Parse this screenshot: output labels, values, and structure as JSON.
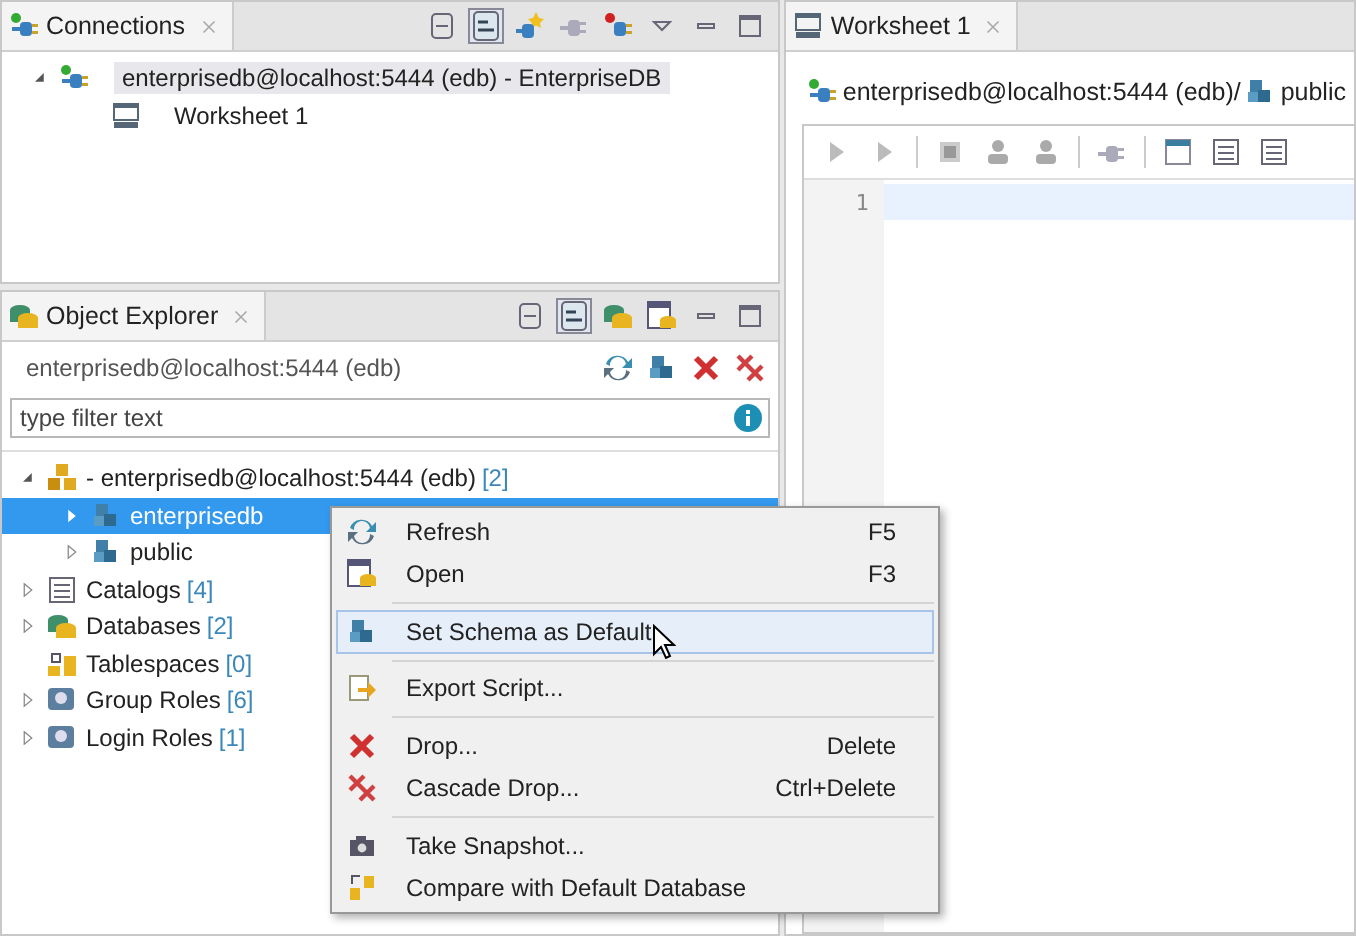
{
  "connections": {
    "tab": "Connections",
    "tree": [
      {
        "label": "enterprisedb@localhost:5444 (edb) - EnterpriseDB",
        "expanded": true,
        "selected": true,
        "children": [
          {
            "label": "Worksheet 1",
            "selected": false
          }
        ]
      }
    ]
  },
  "worksheet": {
    "tab": "Worksheet 1",
    "connection": "enterprisedb@localhost:5444 (edb)/",
    "schema": "public",
    "line_numbers": [
      "1"
    ]
  },
  "object_explorer": {
    "tab": "Object Explorer",
    "connection": "enterprisedb@localhost:5444 (edb)",
    "filter": {
      "placeholder": "type filter text"
    },
    "tree": [
      {
        "label": "- enterprisedb@localhost:5444 (edb)",
        "count": "[2]",
        "expanded": true,
        "selected": false,
        "children": [
          {
            "label": "enterprisedb",
            "expanded": false,
            "selected": true
          },
          {
            "label": "public",
            "expanded": false,
            "selected": false
          }
        ]
      },
      {
        "label": "Catalogs",
        "count": "[4]",
        "expanded": false,
        "selected": false
      },
      {
        "label": "Databases",
        "count": "[2]",
        "expanded": false,
        "selected": false
      },
      {
        "label": "Tablespaces",
        "count": "[0]",
        "selected": false
      },
      {
        "label": "Group Roles",
        "count": "[6]",
        "expanded": false,
        "selected": false
      },
      {
        "label": "Login Roles",
        "count": "[1]",
        "expanded": false,
        "selected": false
      }
    ]
  },
  "context_menu": {
    "items": [
      {
        "kind": "item",
        "label": "Refresh",
        "shortcut": "F5",
        "selected": false
      },
      {
        "kind": "item",
        "label": "Open",
        "shortcut": "F3",
        "selected": false
      },
      {
        "kind": "separator"
      },
      {
        "kind": "item",
        "label": "Set Schema as Default",
        "selected": true
      },
      {
        "kind": "separator"
      },
      {
        "kind": "item",
        "label": "Export Script...",
        "selected": false
      },
      {
        "kind": "separator"
      },
      {
        "kind": "item",
        "label": "Drop...",
        "shortcut": "Delete",
        "selected": false
      },
      {
        "kind": "item",
        "label": "Cascade Drop...",
        "shortcut": "Ctrl+Delete",
        "selected": false
      },
      {
        "kind": "separator"
      },
      {
        "kind": "item",
        "label": "Take Snapshot...",
        "selected": false
      },
      {
        "kind": "item",
        "label": "Compare with Default Database",
        "selected": false
      }
    ]
  }
}
